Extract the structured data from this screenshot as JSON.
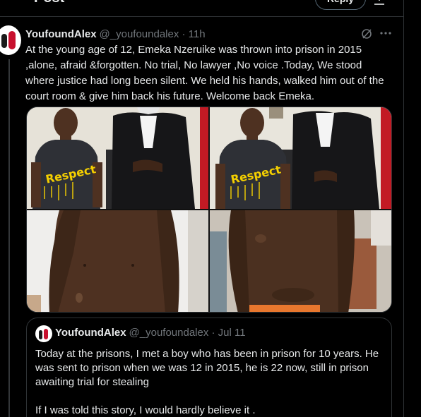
{
  "header": {
    "title": "Post",
    "reply_label": "Reply"
  },
  "tweet": {
    "name": "YoufoundAlex",
    "handle": "@_youfoundalex · 11h",
    "text": "At the young age of 12, Emeka Nzeruike was thrown into prison in 2015 ,alone, afraid &forgotten. No trial, No lawyer ,No voice .Today, We stood where justice had long been silent. We held his hands, walked him out of the court room & give him back his future. Welcome back Emeka.",
    "shirt_text": "Respect"
  },
  "quote": {
    "name": "YoufoundAlex",
    "handle": "@_youfoundalex · Jul 11",
    "paragraph_1": "Today at the prisons, I met a boy who has been in prison for 10 years. He was sent to prison when we was 12 in 2015, he is 22 now, still in prison awaiting trial for stealing",
    "paragraph_2": "If I was told this story, I would hardly believe it ."
  },
  "icons": {
    "more": "more-icon",
    "grok": "grok-icon",
    "filter": "filter-icon"
  },
  "colors": {
    "background": "#000000",
    "text": "#e7e9ea",
    "muted": "#71767b",
    "border": "#2f3336",
    "shirt_print": "#f5d000"
  }
}
